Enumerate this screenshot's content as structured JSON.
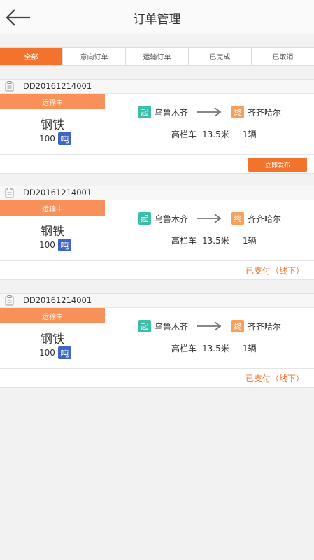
{
  "header": {
    "title": "订单管理",
    "back_icon": "arrow-left-icon"
  },
  "tabs": [
    {
      "label": "全部",
      "active": true
    },
    {
      "label": "意向订单",
      "active": false
    },
    {
      "label": "运输订单",
      "active": false
    },
    {
      "label": "已完成",
      "active": false
    },
    {
      "label": "已取消",
      "active": false
    }
  ],
  "colors": {
    "accent": "#f4732c",
    "start": "#3bbfa8",
    "end": "#f7a05c",
    "unit": "#3c67c5",
    "status": "#f8905a"
  },
  "orders": [
    {
      "order_no": "DD20161214001",
      "status": "运输中",
      "goods": "钢铁",
      "quantity": "100",
      "unit": "吨",
      "start_label": "起",
      "origin": "乌鲁木齐",
      "end_label": "终",
      "destination": "齐齐哈尔",
      "vehicle": "高栏车",
      "length": "13.5米",
      "count": "1辆",
      "action": "立即发布"
    },
    {
      "order_no": "DD20161214001",
      "status": "运输中",
      "goods": "钢铁",
      "quantity": "100",
      "unit": "吨",
      "start_label": "起",
      "origin": "乌鲁木齐",
      "end_label": "终",
      "destination": "齐齐哈尔",
      "vehicle": "高栏车",
      "length": "13.5米",
      "count": "1辆",
      "payment": "已支付（线下）"
    },
    {
      "order_no": "DD20161214001",
      "status": "运输中",
      "goods": "钢铁",
      "quantity": "100",
      "unit": "吨",
      "start_label": "起",
      "origin": "乌鲁木齐",
      "end_label": "终",
      "destination": "齐齐哈尔",
      "vehicle": "高栏车",
      "length": "13.5米",
      "count": "1辆",
      "payment": "已支付（线下）"
    }
  ]
}
